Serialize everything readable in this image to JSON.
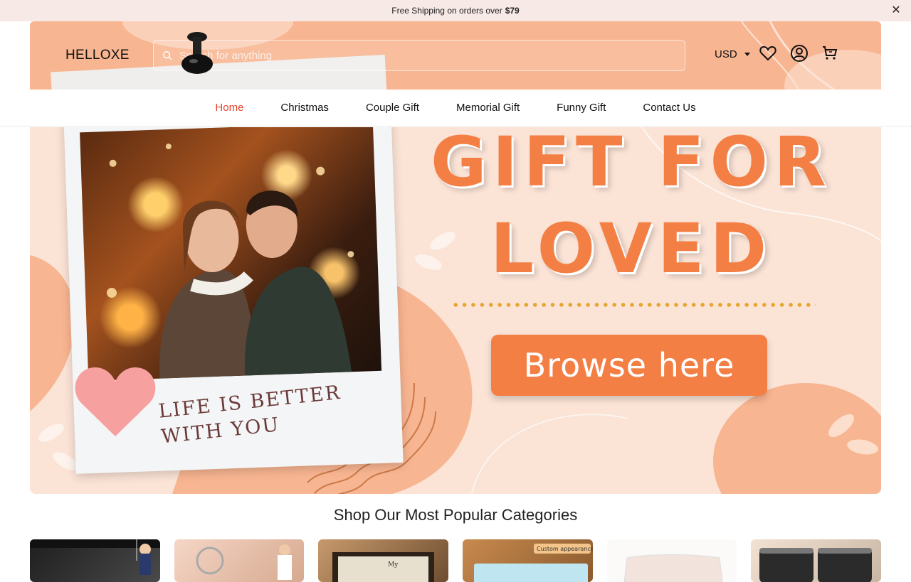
{
  "announcement": {
    "text": "Free Shipping on orders over",
    "amount": "$79",
    "close_label": "✕"
  },
  "header": {
    "logo": "HELLOXE",
    "search_placeholder": "Search for anything",
    "currency": "USD",
    "icons": [
      "heart-icon",
      "account-icon",
      "cart-icon"
    ]
  },
  "nav": {
    "items": [
      {
        "label": "Home",
        "active": true
      },
      {
        "label": "Christmas",
        "active": false
      },
      {
        "label": "Couple Gift",
        "active": false
      },
      {
        "label": "Memorial Gift",
        "active": false
      },
      {
        "label": "Funny Gift",
        "active": false
      },
      {
        "label": "Contact Us",
        "active": false
      }
    ]
  },
  "hero": {
    "headline_line1": "GIFT FOR",
    "headline_line2": "LOVED",
    "button": "Browse here",
    "caption_line1": "LIFE IS BETTER",
    "caption_line2": "WITH YOU"
  },
  "categories": {
    "title": "Shop Our Most Popular Categories",
    "tiles": [
      {
        "name": "category-car-hanger",
        "color": "#2a2a2a"
      },
      {
        "name": "category-keychain",
        "color": "#e9c9b8"
      },
      {
        "name": "category-frame",
        "color": "#8c6a4b"
      },
      {
        "name": "category-doormat",
        "color": "#b4773f"
      },
      {
        "name": "category-pillow",
        "color": "#f1eeec"
      },
      {
        "name": "category-tumbler",
        "color": "#3a3a3a"
      }
    ],
    "tile_badge": "Custom appearance"
  },
  "colors": {
    "accent": "#f47f45",
    "header_bg": "#f8b591",
    "nav_active": "#e8452c",
    "announce_bg": "#f7e9e6"
  }
}
